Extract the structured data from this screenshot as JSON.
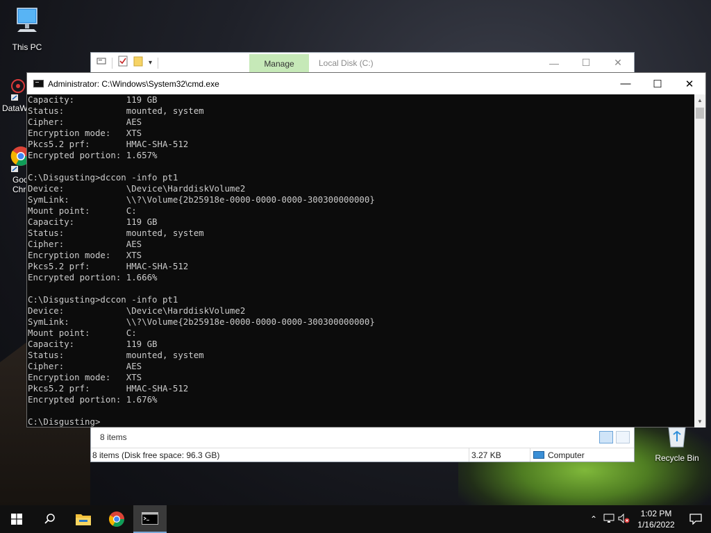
{
  "desktop": {
    "icons": [
      {
        "label": "This PC"
      },
      {
        "label": "DataW"
      },
      {
        "label": "Goo Chro"
      },
      {
        "label": "Recycle Bin"
      }
    ]
  },
  "explorer": {
    "manage_tab": "Manage",
    "title": "Local Disk (C:)",
    "items_count": "8 items",
    "status_left": "8 items (Disk free space: 96.3 GB)",
    "status_size": "3.27 KB",
    "status_location": "Computer"
  },
  "cmd": {
    "title": "Administrator: C:\\Windows\\System32\\cmd.exe",
    "lines": [
      "Capacity:          119 GB",
      "Status:            mounted, system",
      "Cipher:            AES",
      "Encryption mode:   XTS",
      "Pkcs5.2 prf:       HMAC-SHA-512",
      "Encrypted portion: 1.657%",
      "",
      "C:\\Disgusting>dccon -info pt1",
      "Device:            \\Device\\HarddiskVolume2",
      "SymLink:           \\\\?\\Volume{2b25918e-0000-0000-0000-300300000000}",
      "Mount point:       C:",
      "Capacity:          119 GB",
      "Status:            mounted, system",
      "Cipher:            AES",
      "Encryption mode:   XTS",
      "Pkcs5.2 prf:       HMAC-SHA-512",
      "Encrypted portion: 1.666%",
      "",
      "C:\\Disgusting>dccon -info pt1",
      "Device:            \\Device\\HarddiskVolume2",
      "SymLink:           \\\\?\\Volume{2b25918e-0000-0000-0000-300300000000}",
      "Mount point:       C:",
      "Capacity:          119 GB",
      "Status:            mounted, system",
      "Cipher:            AES",
      "Encryption mode:   XTS",
      "Pkcs5.2 prf:       HMAC-SHA-512",
      "Encrypted portion: 1.676%",
      "",
      "C:\\Disgusting>"
    ]
  },
  "taskbar": {
    "time": "1:02 PM",
    "date": "1/16/2022"
  }
}
